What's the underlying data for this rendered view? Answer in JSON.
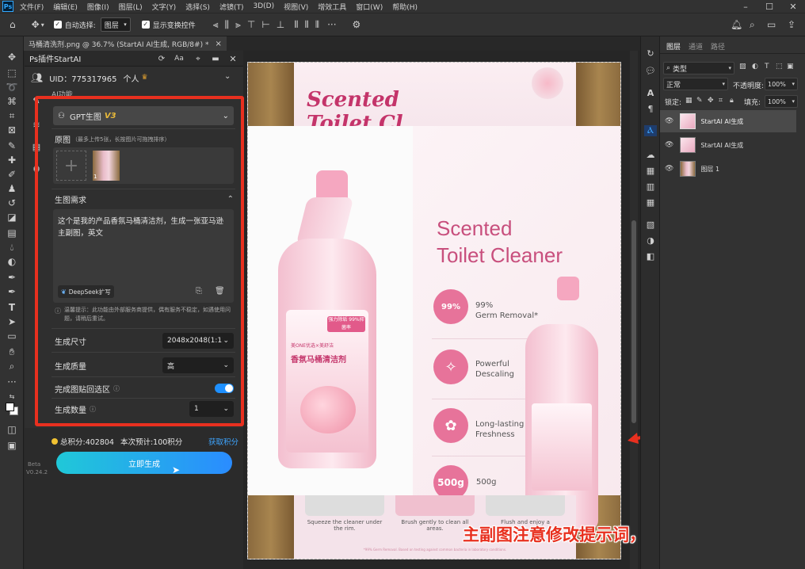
{
  "menu": [
    "文件(F)",
    "编辑(E)",
    "图像(I)",
    "图层(L)",
    "文字(Y)",
    "选择(S)",
    "滤镜(T)",
    "3D(D)",
    "视图(V)",
    "增效工具",
    "窗口(W)",
    "帮助(H)"
  ],
  "app_logo": "Ps",
  "options": {
    "auto_select_label": "自动选择:",
    "auto_select_value": "图层",
    "show_transform_label": "显示变换控件"
  },
  "document_tab": {
    "title": "马桶清洗剂.png @ 36.7% (StartAI AI生成, RGB/8#) *",
    "close": "×"
  },
  "plugin": {
    "title": "Ps插件StartAI",
    "header_icons": [
      "refresh-icon",
      "font-size-icon",
      "pin-icon",
      "minimize-icon",
      "close-icon"
    ],
    "uid": "UID：775317965",
    "account_type": "个人",
    "tab_label": "AI功能",
    "model": "GPT生图",
    "model_version": "V3",
    "source_label": "原图",
    "source_hint": "（最多上传5张，长按图片可拖拽排序）",
    "thumb_index": "1",
    "requirement_label": "生图需求",
    "prompt_text": "这个是我的产品香氛马桶清洁剂，生成一张亚马逊主副图，英文",
    "deepseek_label": "DeepSeek扩写",
    "notice": "温馨提示：此功能由外部服务商提供，偶有服务不稳定，如遇使用问题，请稍后重试。",
    "size_label": "生成尺寸",
    "size_value": "2048x2048(1:1)",
    "quality_label": "生成质量",
    "quality_value": "高",
    "paste_label": "完成图贴回选区",
    "paste_on": true,
    "count_label": "生成数量",
    "count_value": "1",
    "points": "总积分:402804",
    "estimate": "本次预计:100积分",
    "get_points": "获取积分",
    "generate_button": "立即生成",
    "version_beta": "Beta",
    "version": "V0.24.2"
  },
  "canvas": {
    "back_title_1": "Scented",
    "back_title_2": "Toilet Cl",
    "title_1": "Scented",
    "title_2": "Toilet Cleaner",
    "features": [
      {
        "badge": "99%",
        "text_1": "99%",
        "text_2": "Germ Removal*"
      },
      {
        "badge": "✧",
        "text_1": "Powerful",
        "text_2": "Descaling"
      },
      {
        "badge": "✿",
        "text_1": "Long-lasting",
        "text_2": "Freshness"
      },
      {
        "badge": "500g",
        "text_1": "500g",
        "text_2": ""
      }
    ],
    "bottle_label_cn": "香氛马桶清洁剂",
    "bottle_brand": "美ONE优选×美舒洁",
    "bottle_tag": "强力除垢 99%抑菌率",
    "steps": [
      "Squeeze the cleaner under the rim.",
      "Brush gently to clean all areas.",
      "Flush and enjoy a"
    ],
    "footnote": "*99% Germ Removal. Based on testing against common bacteria in laboratory conditions."
  },
  "annotation_text": "主副图注意修改提示词，生成尺寸",
  "layers_panel": {
    "tabs": [
      "图层",
      "通道",
      "路径"
    ],
    "filter_label": "类型",
    "blend_mode": "正常",
    "opacity_label": "不透明度:",
    "opacity_value": "100%",
    "lock_label": "锁定:",
    "fill_label": "填充:",
    "fill_value": "100%",
    "layers": [
      {
        "name": "StartAI AI生成",
        "selected": true
      },
      {
        "name": "StartAI AI生成",
        "selected": false
      },
      {
        "name": "图层 1",
        "selected": false
      }
    ]
  },
  "colors": {
    "accent_red": "#e8301f",
    "pink": "#e25a8a",
    "teal": "#25c4d8",
    "blue": "#1e90ff"
  }
}
